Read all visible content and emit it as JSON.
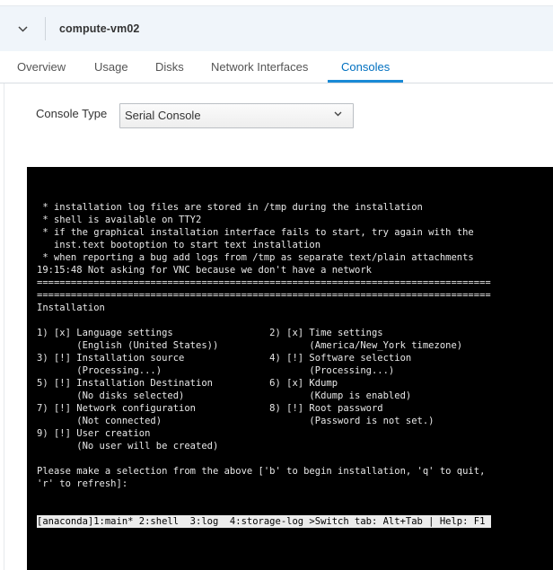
{
  "header": {
    "vm_name": "compute-vm02"
  },
  "tabs": [
    {
      "label": "Overview",
      "active": false
    },
    {
      "label": "Usage",
      "active": false
    },
    {
      "label": "Disks",
      "active": false
    },
    {
      "label": "Network Interfaces",
      "active": false
    },
    {
      "label": "Consoles",
      "active": true
    }
  ],
  "console": {
    "type_label": "Console Type",
    "type_value": "Serial Console"
  },
  "terminal": {
    "lines": [
      " * installation log files are stored in /tmp during the installation",
      " * shell is available on TTY2",
      " * if the graphical installation interface fails to start, try again with the",
      "   inst.text bootoption to start text installation",
      " * when reporting a bug add logs from /tmp as separate text/plain attachments",
      "19:15:48 Not asking for VNC because we don't have a network",
      "================================================================================",
      "================================================================================",
      "Installation",
      "",
      "1) [x] Language settings                 2) [x] Time settings",
      "       (English (United States))                (America/New_York timezone)",
      "3) [!] Installation source               4) [!] Software selection",
      "       (Processing...)                          (Processing...)",
      "5) [!] Installation Destination          6) [x] Kdump",
      "       (No disks selected)                      (Kdump is enabled)",
      "7) [!] Network configuration             8) [!] Root password",
      "       (Not connected)                          (Password is not set.)",
      "9) [!] User creation",
      "       (No user will be created)",
      "",
      "Please make a selection from the above ['b' to begin installation, 'q' to quit,",
      "'r' to refresh]:"
    ],
    "status_bar": "[anaconda]1:main* 2:shell  3:log  4:storage-log >Switch tab: Alt+Tab | Help: F1 "
  },
  "colors": {
    "accent": "#1a8ad6",
    "header_bg": "#f0f5fa",
    "terminal_bg": "#000000"
  },
  "icons": {
    "toggle": "chevron-down-icon",
    "select": "chevron-down-icon"
  }
}
